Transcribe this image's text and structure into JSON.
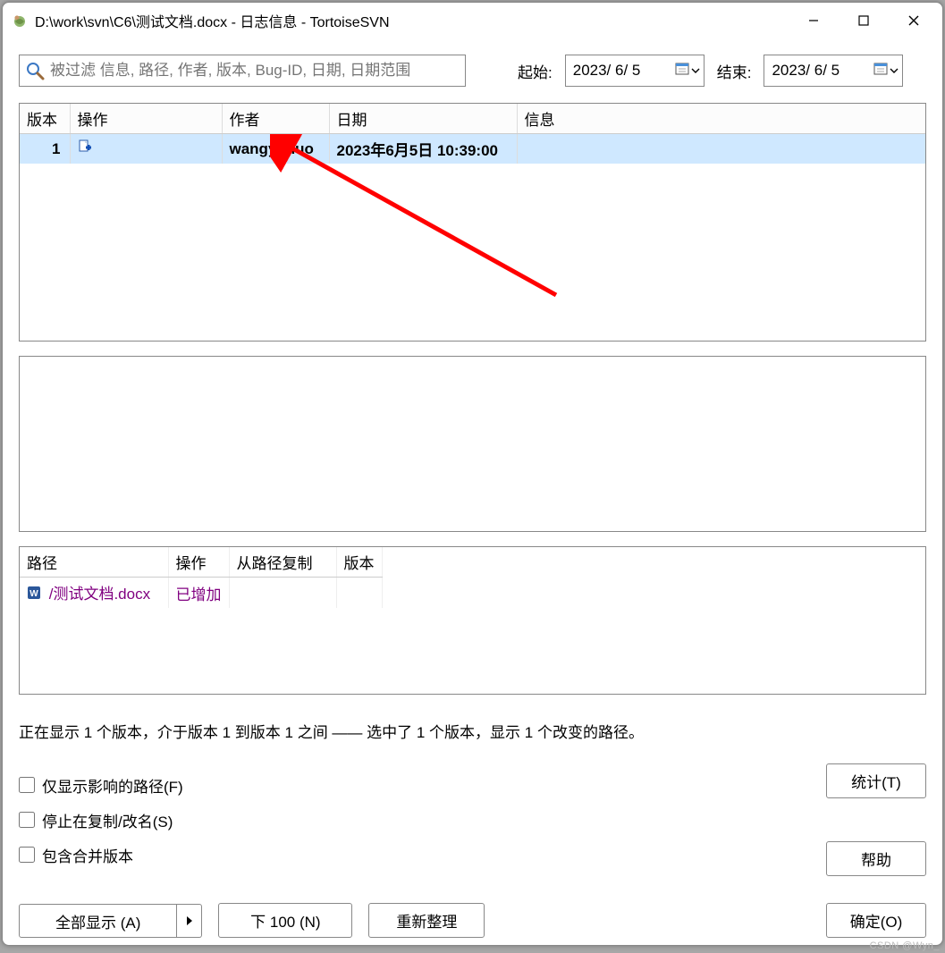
{
  "window": {
    "title": "D:\\work\\svn\\C6\\测试文档.docx - 日志信息 - TortoiseSVN"
  },
  "filter": {
    "placeholder": "被过滤 信息, 路径, 作者, 版本, Bug-ID, 日期, 日期范围"
  },
  "from": {
    "label": "起始:",
    "value": "2023/ 6/ 5"
  },
  "to": {
    "label": "结束:",
    "value": "2023/ 6/ 5"
  },
  "log": {
    "headers": {
      "rev": "版本",
      "action": "操作",
      "author": "作者",
      "date": "日期",
      "msg": "信息"
    },
    "rows": [
      {
        "rev": "1",
        "author": "wangyunuo",
        "date": "2023年6月5日 10:39:00",
        "msg": ""
      }
    ]
  },
  "paths": {
    "headers": {
      "path": "路径",
      "action": "操作",
      "copyfrom": "从路径复制",
      "rev": "版本"
    },
    "rows": [
      {
        "path": "/测试文档.docx",
        "action": "已增加",
        "copyfrom": "",
        "rev": ""
      }
    ]
  },
  "status_line": "正在显示 1 个版本，介于版本 1 到版本 1 之间 —— 选中了 1 个版本，显示 1 个改变的路径。",
  "checks": {
    "affected": "仅显示影响的路径(F)",
    "stop_copy": "停止在复制/改名(S)",
    "include_merge": "包含合并版本"
  },
  "buttons": {
    "stats": "统计(T)",
    "help": "帮助",
    "show_all": "全部显示 (A)",
    "next100": "下 100 (N)",
    "refresh": "重新整理",
    "ok": "确定(O)"
  },
  "watermark": "CSDN @Wyn_"
}
